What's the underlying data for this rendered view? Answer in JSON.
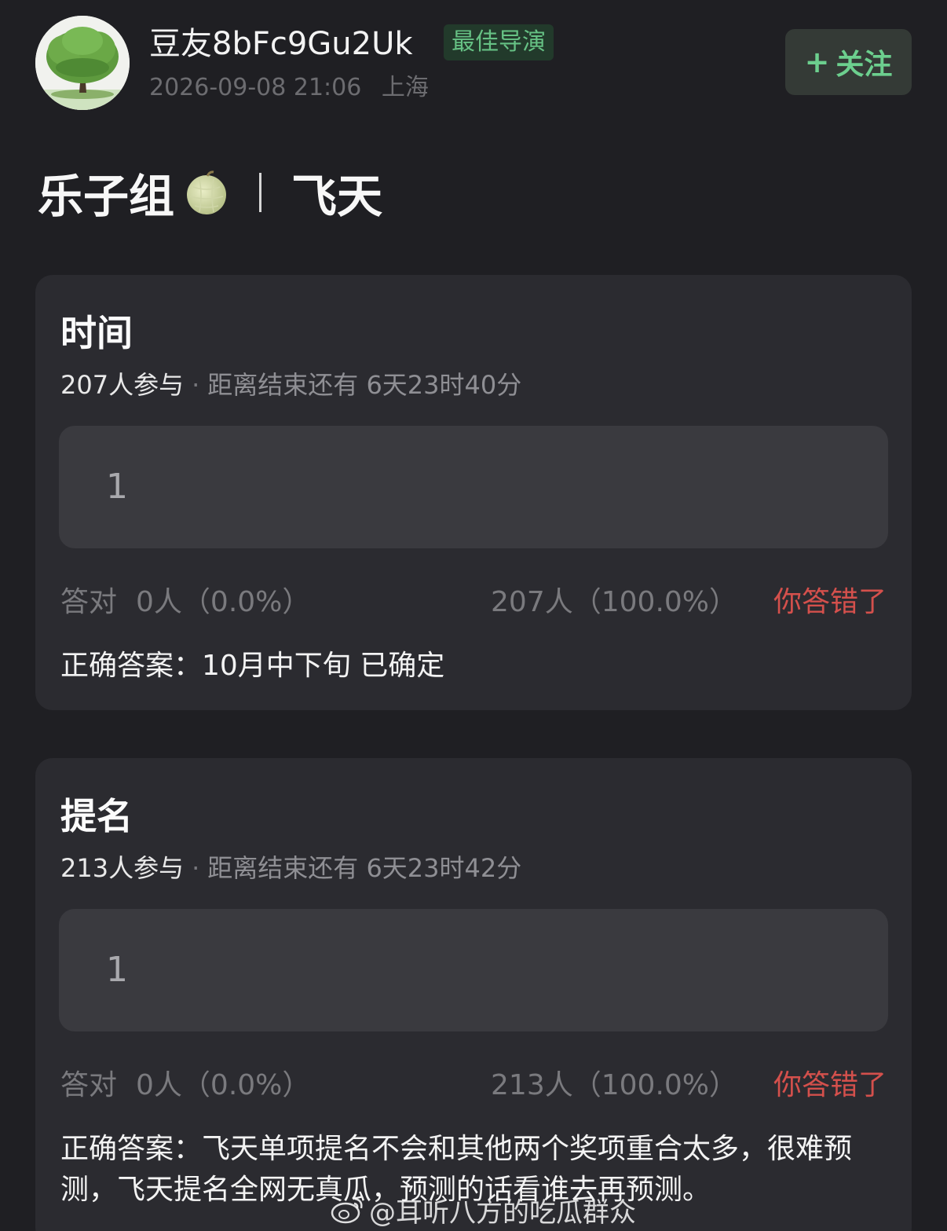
{
  "header": {
    "username": "豆友8bFc9Gu2Uk",
    "badge": "最佳导演",
    "timestamp": "2026-09-08 21:06",
    "location": "上海",
    "follow_label": "关注",
    "follow_icon": "plus-icon",
    "avatar_icon": "tree-avatar"
  },
  "title": {
    "group": "乐子组",
    "emoji_icon": "melon-icon",
    "topic": "飞天"
  },
  "cards": [
    {
      "heading": "时间",
      "participants": "207人参与",
      "separator": "·",
      "deadline": "距离结束还有 6天23时40分",
      "my_answer": "1",
      "correct_label": "答对",
      "correct_count": "0人（0.0%）",
      "wrong_count": "207人（100.0%）",
      "result": "你答错了",
      "correct_answer": "正确答案：10月中下旬 已确定"
    },
    {
      "heading": "提名",
      "participants": "213人参与",
      "separator": "·",
      "deadline": "距离结束还有 6天23时42分",
      "my_answer": "1",
      "correct_label": "答对",
      "correct_count": "0人（0.0%）",
      "wrong_count": "213人（100.0%）",
      "result": "你答错了",
      "correct_answer": "正确答案：飞天单项提名不会和其他两个奖项重合太多，很难预测，飞天提名全网无真瓜，预测的话看谁去再预测。"
    }
  ],
  "watermark": {
    "text": "@耳听八方的吃瓜群众",
    "icon": "weibo-icon"
  },
  "colors": {
    "background": "#1f1f23",
    "card": "#2b2b30",
    "answer_box": "#3a3a3f",
    "accent_green": "#6ccf8e",
    "badge_bg": "#223a2b",
    "wrong_red": "#d4504c"
  }
}
